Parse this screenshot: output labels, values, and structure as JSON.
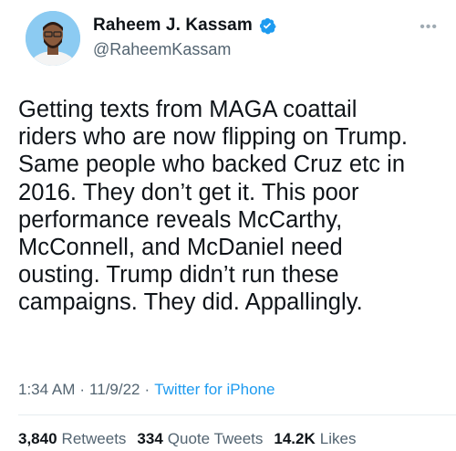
{
  "author": {
    "display_name": "Raheem J. Kassam",
    "handle": "@RaheemKassam",
    "verified": true
  },
  "tweet": {
    "text": "Getting texts from MAGA coattail\nriders who are now flipping on Trump.\nSame people who backed Cruz etc in\n2016. They don’t get it. This poor\nperformance reveals McCarthy,\nMcConnell, and McDaniel need\nousting. Trump didn’t run these\ncampaigns. They did. Appallingly.",
    "time": "1:34 AM",
    "date": "11/9/22",
    "separator": "·",
    "source": "Twitter for iPhone"
  },
  "stats": {
    "retweets_count": "3,840",
    "retweets_label": "Retweets",
    "quotes_count": "334",
    "quotes_label": "Quote Tweets",
    "likes_count": "14.2K",
    "likes_label": "Likes"
  },
  "icons": {
    "verified": "verified-badge-icon",
    "more": "more-options-icon"
  },
  "colors": {
    "accent": "#1d9bf0",
    "secondary_text": "#536471",
    "primary_text": "#0f1419"
  }
}
